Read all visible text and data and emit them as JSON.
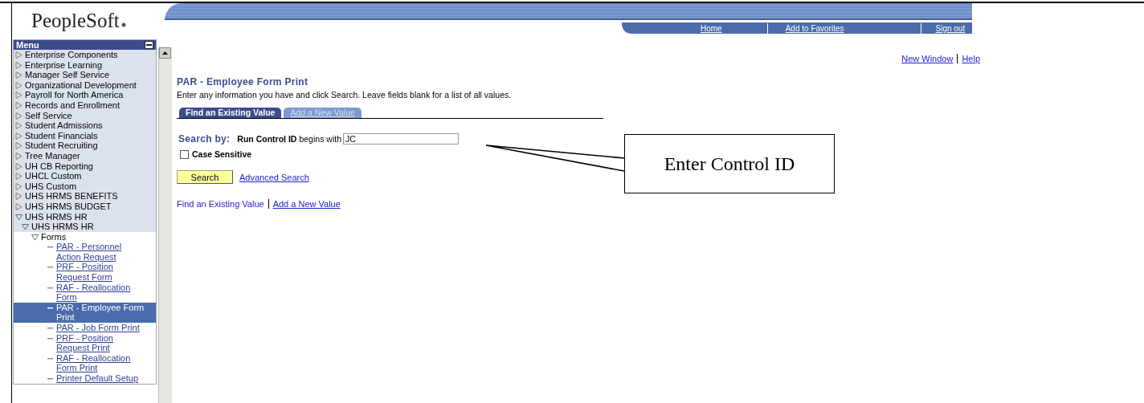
{
  "header": {
    "logo": "PeopleSoft",
    "nav_links": [
      "Home",
      "Add to Favorites",
      "Sign out"
    ]
  },
  "utility_links": [
    "New Window",
    "Help"
  ],
  "menu": {
    "title": "Menu",
    "items": [
      {
        "label": "Enterprise Components",
        "expanded": false
      },
      {
        "label": "Enterprise Learning",
        "expanded": false
      },
      {
        "label": "Manager Self Service",
        "expanded": false
      },
      {
        "label": "Organizational Development",
        "expanded": false
      },
      {
        "label": "Payroll for North America",
        "expanded": false
      },
      {
        "label": "Records and Enrollment",
        "expanded": false
      },
      {
        "label": "Self Service",
        "expanded": false
      },
      {
        "label": "Student Admissions",
        "expanded": false
      },
      {
        "label": "Student Financials",
        "expanded": false
      },
      {
        "label": "Student Recruiting",
        "expanded": false
      },
      {
        "label": "Tree Manager",
        "expanded": false
      },
      {
        "label": "UH CB Reporting",
        "expanded": false
      },
      {
        "label": "UHCL Custom",
        "expanded": false
      },
      {
        "label": "UHS Custom",
        "expanded": false
      },
      {
        "label": "UHS HRMS BENEFITS",
        "expanded": false
      },
      {
        "label": "UHS HRMS BUDGET",
        "expanded": false
      },
      {
        "label": "UHS HRMS HR",
        "expanded": true,
        "children": [
          {
            "label": "UHS HRMS HR",
            "expanded": true,
            "children": [
              {
                "label": "Forms",
                "expanded": true,
                "children": [
                  {
                    "label": "PAR - Personnel Action Request",
                    "selected": false
                  },
                  {
                    "label": "PRF - Position Request Form",
                    "selected": false
                  },
                  {
                    "label": "RAF - Reallocation Form",
                    "selected": false
                  },
                  {
                    "label": "PAR - Employee Form Print",
                    "selected": true
                  },
                  {
                    "label": "PAR - Job Form Print",
                    "selected": false
                  },
                  {
                    "label": "PRF - Position Request Print",
                    "selected": false
                  },
                  {
                    "label": "RAF - Reallocation Form Print",
                    "selected": false
                  },
                  {
                    "label": "Printer Default Setup",
                    "selected": false
                  }
                ]
              }
            ]
          }
        ]
      }
    ]
  },
  "page": {
    "title": "PAR - Employee Form Print",
    "instructions": "Enter any information you have and click Search. Leave fields blank for a list of all values.",
    "tabs": [
      {
        "label": "Find an Existing Value",
        "selected": true
      },
      {
        "label": "Add a New Value",
        "selected": false
      }
    ],
    "search": {
      "label": "Search by:",
      "field_label": "Run Control ID",
      "operator": "begins with",
      "value": "JC"
    },
    "case_sensitive": {
      "label": "Case Sensitive",
      "checked": false
    },
    "search_button": "Search",
    "advanced_search": "Advanced Search",
    "bottom_links": [
      "Find an Existing Value",
      "Add a New Value"
    ]
  },
  "callout": {
    "text": "Enter Control ID"
  }
}
